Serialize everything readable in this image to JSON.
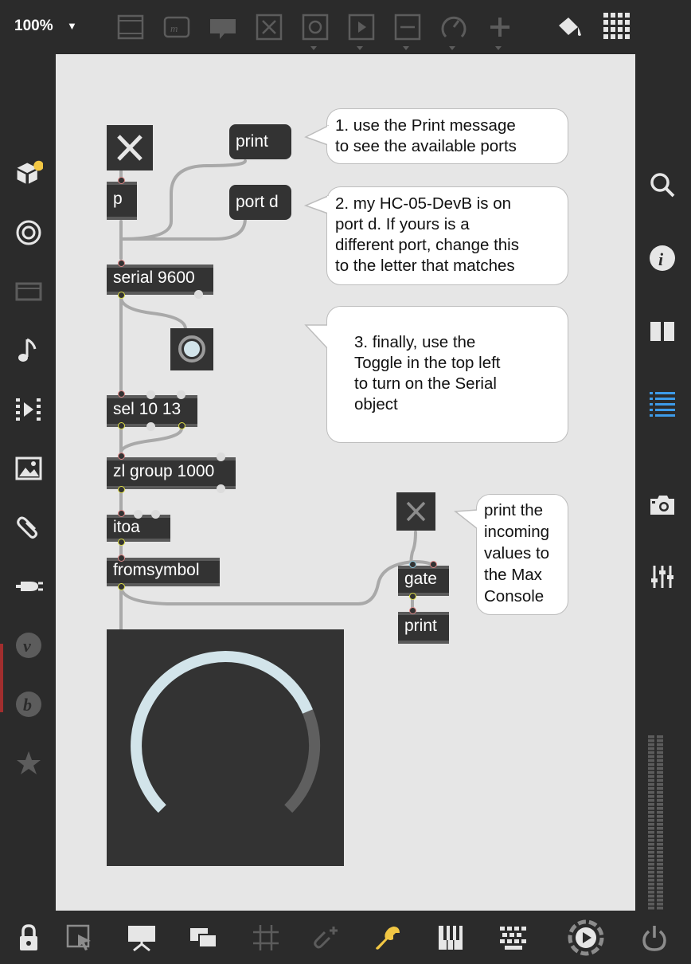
{
  "toolbar": {
    "zoom": "100%",
    "icons": [
      "presentation-frame-icon",
      "comment-icon",
      "speech-bubble-icon",
      "toggle-object-icon",
      "button-object-icon",
      "message-object-icon",
      "slider-object-icon",
      "dial-object-icon",
      "add-object-icon",
      "format-paint-icon",
      "grid-palette-icon"
    ]
  },
  "left_sidebar": {
    "icons": [
      "package-icon",
      "target-icon",
      "media-icon",
      "music-note-icon",
      "sequence-icon",
      "image-icon",
      "paperclip-icon",
      "plug-icon",
      "v-icon",
      "b-icon",
      "star-icon"
    ]
  },
  "right_sidebar": {
    "icons": [
      "search-icon",
      "info-icon",
      "columns-icon",
      "list-icon",
      "camera-icon",
      "mixer-icon",
      "level-meter-icon"
    ]
  },
  "bottom_bar": {
    "icons": [
      "lock-icon",
      "select-cursor-icon",
      "presentation-icon",
      "windows-icon",
      "grid-icon",
      "attach-icon",
      "wrench-icon",
      "piano-icon",
      "keyboard-icon",
      "play-audio-icon",
      "power-icon"
    ]
  },
  "patch": {
    "objects": {
      "p": "p",
      "serial": "serial 9600",
      "sel": "sel 10 13",
      "zl": "zl group 1000",
      "itoa": "itoa",
      "fromsymbol": "fromsymbol",
      "gate": "gate",
      "print_obj": "print"
    },
    "messages": {
      "print": "print",
      "port": "port d"
    },
    "comments": {
      "c1_l1": "1. use the Print message",
      "c1_l2": "to see the available ports",
      "c2_l1": "2. my HC-05-DevB is on",
      "c2_l2": "port d. If yours is a",
      "c2_l3": "different port, change this",
      "c2_l4": "to the letter that matches",
      "c3_l1": "3. finally, use the",
      "c3_l2": "Toggle in the top left",
      "c3_l3": "to turn on the Serial",
      "c3_l4": "object",
      "c4_l1": "print the",
      "c4_l2": "incoming",
      "c4_l3": "values to",
      "c4_l4": "the Max",
      "c4_l5": "Console"
    },
    "dial_value": 0.75
  },
  "colors": {
    "canvas": "#e6e6e6",
    "object": "#333333",
    "accent_blue": "#3d9be9",
    "accent_yellow": "#f2c744",
    "dial_fill": "#d2e4ea",
    "dial_track": "#5f5f5f"
  }
}
